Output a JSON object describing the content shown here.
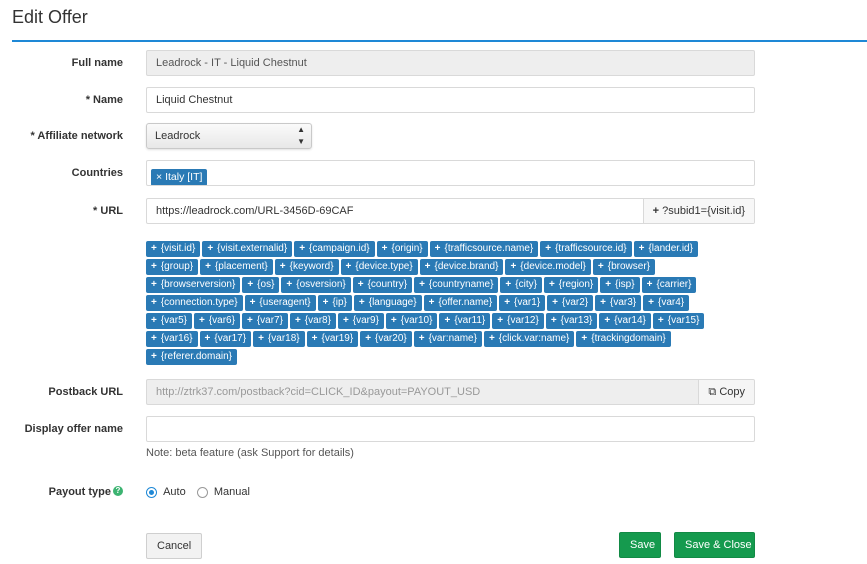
{
  "page": {
    "title": "Edit Offer"
  },
  "fields": {
    "full_name": {
      "label": "Full name",
      "value": "Leadrock - IT - Liquid Chestnut"
    },
    "name": {
      "label": "* Name",
      "value": "Liquid Chestnut"
    },
    "affiliate_network": {
      "label": "* Affiliate network",
      "value": "Leadrock"
    },
    "countries": {
      "label": "Countries",
      "chips": [
        "Italy [IT]"
      ]
    },
    "url": {
      "label": "* URL",
      "value": "https://leadrock.com/URL-3456D-69CAF",
      "addon": "?subid1={visit.id}"
    },
    "postback_url": {
      "label": "Postback URL",
      "value": "http://ztrk37.com/postback?cid=CLICK_ID&payout=PAYOUT_USD",
      "copy_label": "Copy"
    },
    "display_offer_name": {
      "label": "Display offer name",
      "value": "",
      "note": "Note: beta feature (ask Support for details)"
    },
    "payout_type": {
      "label": "Payout type",
      "help": "?",
      "options": [
        "Auto",
        "Manual"
      ],
      "selected": "Auto"
    }
  },
  "macros": [
    "{visit.id}",
    "{visit.externalid}",
    "{campaign.id}",
    "{origin}",
    "{trafficsource.name}",
    "{trafficsource.id}",
    "{lander.id}",
    "{group}",
    "{placement}",
    "{keyword}",
    "{device.type}",
    "{device.brand}",
    "{device.model}",
    "{browser}",
    "{browserversion}",
    "{os}",
    "{osversion}",
    "{country}",
    "{countryname}",
    "{city}",
    "{region}",
    "{isp}",
    "{carrier}",
    "{connection.type}",
    "{useragent}",
    "{ip}",
    "{language}",
    "{offer.name}",
    "{var1}",
    "{var2}",
    "{var3}",
    "{var4}",
    "{var5}",
    "{var6}",
    "{var7}",
    "{var8}",
    "{var9}",
    "{var10}",
    "{var11}",
    "{var12}",
    "{var13}",
    "{var14}",
    "{var15}",
    "{var16}",
    "{var17}",
    "{var18}",
    "{var19}",
    "{var20}",
    "{var:name}",
    "{click.var:name}",
    "{trackingdomain}",
    "{referer.domain}"
  ],
  "icons": {
    "plus": "plus-icon",
    "copy": "copy-icon",
    "remove": "close-icon",
    "sort": "updown-arrows-icon"
  },
  "buttons": {
    "cancel": "Cancel",
    "save": "Save",
    "save_close": "Save & Close"
  },
  "colors": {
    "accent": "#1e88d6",
    "chip": "#2a7ab5",
    "success": "#159a4e"
  }
}
